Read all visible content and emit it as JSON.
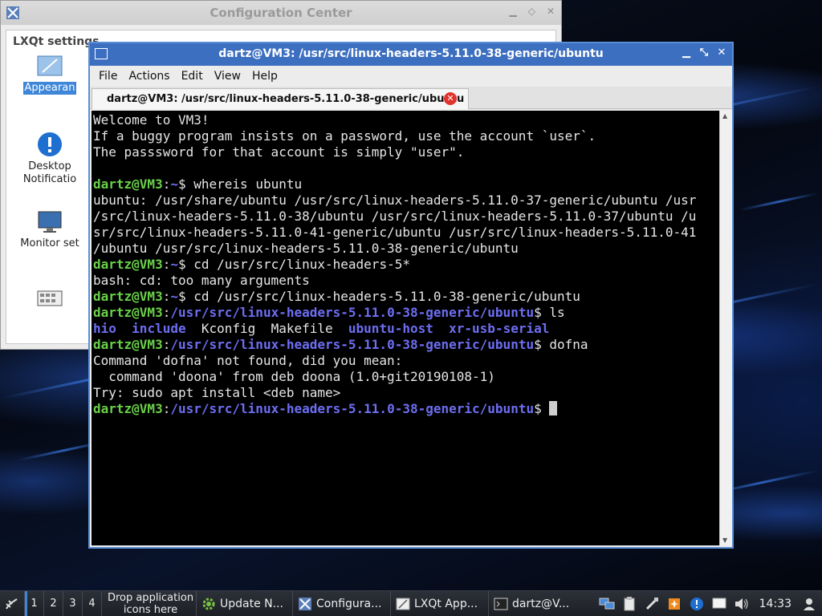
{
  "config_center": {
    "title": "Configuration Center",
    "section_title": "LXQt settings",
    "items": [
      {
        "label": "Appearan",
        "icon": "appearance-icon"
      },
      {
        "label": "Desktop",
        "label2": "Notificatio",
        "icon": "notification-icon"
      },
      {
        "label": "Monitor set",
        "icon": "monitor-icon"
      },
      {
        "label": "",
        "icon": "keyboard-icon"
      }
    ]
  },
  "terminal": {
    "title": "dartz@VM3: /usr/src/linux-headers-5.11.0-38-generic/ubuntu",
    "menu": [
      "File",
      "Actions",
      "Edit",
      "View",
      "Help"
    ],
    "tab_label": "dartz@VM3: /usr/src/linux-headers-5.11.0-38-generic/ubuntu",
    "colors": {
      "user": "#6ad04a",
      "path": "#6d6ef2",
      "text": "#e6e6e6"
    },
    "lines": {
      "welcome1": "Welcome to VM3!",
      "welcome2": "If a buggy program insists on a password, use the account `user`.",
      "welcome3": "The passsword for that account is simply \"user\".",
      "prompt_user": "dartz@VM3",
      "home": "~",
      "cwd": "/usr/src/linux-headers-5.11.0-38-generic/ubuntu",
      "cmd1": "$ whereis ubuntu",
      "out1a": "ubuntu: /usr/share/ubuntu /usr/src/linux-headers-5.11.0-37-generic/ubuntu /usr",
      "out1b": "/src/linux-headers-5.11.0-38/ubuntu /usr/src/linux-headers-5.11.0-37/ubuntu /u",
      "out1c": "sr/src/linux-headers-5.11.0-41-generic/ubuntu /usr/src/linux-headers-5.11.0-41",
      "out1d": "/ubuntu /usr/src/linux-headers-5.11.0-38-generic/ubuntu",
      "cmd2": "$ cd /usr/src/linux-headers-5*",
      "out2": "bash: cd: too many arguments",
      "cmd3": "$ cd /usr/src/linux-headers-5.11.0-38-generic/ubuntu",
      "cmd4": "$ ls",
      "ls_hio": "hio",
      "ls_include": "include",
      "ls_kconfig": "Kconfig",
      "ls_makefile": "Makefile",
      "ls_ubuntuhost": "ubuntu-host",
      "ls_xrusb": "xr-usb-serial",
      "cmd5": "$ dofna",
      "out5a": "Command 'dofna' not found, did you mean:",
      "out5b": "  command 'doona' from deb doona (1.0+git20190108-1)",
      "out5c": "Try: sudo apt install <deb name>",
      "prompt_end": "$ ",
      "colon": ":"
    }
  },
  "taskbar": {
    "desktops": [
      "1",
      "2",
      "3",
      "4"
    ],
    "drop_line1": "Drop application",
    "drop_line2": "icons here",
    "tasks": [
      {
        "label": "Update N...",
        "icon": "gear-icon"
      },
      {
        "label": "Configura...",
        "icon": "config-center-icon"
      },
      {
        "label": "LXQt App...",
        "icon": "appearance-icon"
      },
      {
        "label": "dartz@V...",
        "icon": "terminal-icon"
      }
    ],
    "clock": "14:33"
  }
}
